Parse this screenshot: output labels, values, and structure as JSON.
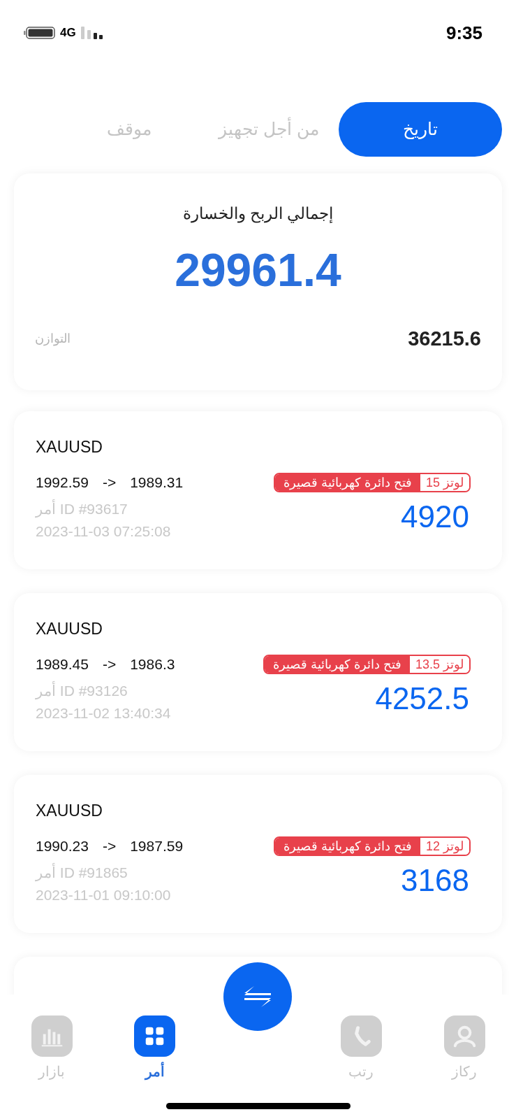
{
  "status_bar": {
    "network": "4G",
    "time": "9:35"
  },
  "tabs": [
    {
      "label": "تاريخ",
      "selected": true
    },
    {
      "label": "من أجل تجهيز",
      "selected": false
    },
    {
      "label": "موقف",
      "selected": false
    }
  ],
  "summary": {
    "title": "إجمالي الربح والخسارة",
    "total": "29961.4",
    "balance_label": "التوازن",
    "balance_value": "36215.6"
  },
  "trades": [
    {
      "symbol": "XAUUSD",
      "open_price": "1992.59",
      "arrow": "->",
      "close_price": "1989.31",
      "lots": "لوتز 15",
      "type": "فتح دائرة كهربائية قصيرة",
      "order_id": "أمر ID #93617",
      "time": "2023-11-03 07:25:08",
      "profit": "4920"
    },
    {
      "symbol": "XAUUSD",
      "open_price": "1989.45",
      "arrow": "->",
      "close_price": "1986.3",
      "lots": "لوتز 13.5",
      "type": "فتح دائرة كهربائية قصيرة",
      "order_id": "أمر ID #93126",
      "time": "2023-11-02 13:40:34",
      "profit": "4252.5"
    },
    {
      "symbol": "XAUUSD",
      "open_price": "1990.23",
      "arrow": "->",
      "close_price": "1987.59",
      "lots": "لوتز 12",
      "type": "فتح دائرة كهربائية قصيرة",
      "order_id": "أمر ID #91865",
      "time": "2023-11-01 09:10:00",
      "profit": "3168"
    }
  ],
  "bottom_nav": [
    {
      "label": "ركاز",
      "kind": "profile",
      "selected": false
    },
    {
      "label": "رتب",
      "kind": "phone",
      "selected": false
    },
    {
      "kind": "swap"
    },
    {
      "label": "أمر",
      "kind": "grid",
      "selected": true
    },
    {
      "label": "بازار",
      "kind": "chart",
      "selected": false
    }
  ]
}
